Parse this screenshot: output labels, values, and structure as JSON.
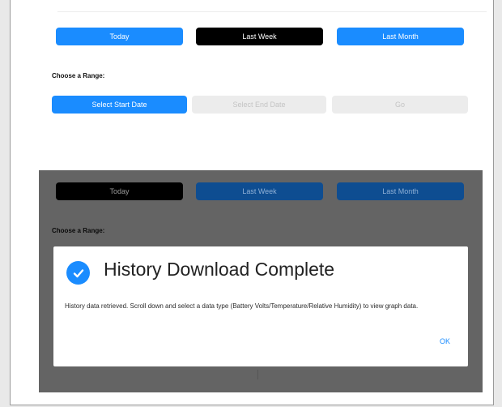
{
  "top": {
    "range_buttons": {
      "today": "Today",
      "last_week": "Last Week",
      "last_month": "Last Month"
    },
    "choose_range_label": "Choose a Range:",
    "date_buttons": {
      "start": "Select Start Date",
      "end": "Select End Date",
      "go": "Go"
    }
  },
  "background_view": {
    "range_buttons": {
      "today": "Today",
      "last_week": "Last Week",
      "last_month": "Last Month"
    },
    "choose_range_label": "Choose a Range:"
  },
  "dialog": {
    "title": "History Download Complete",
    "message": "History data retrieved. Scroll down and select a data type (Battery Volts/Temperature/Relative Humidity) to view graph data.",
    "ok": "OK"
  },
  "colors": {
    "accent": "#1a8cff",
    "selected": "#000000",
    "overlay": "#646464"
  }
}
